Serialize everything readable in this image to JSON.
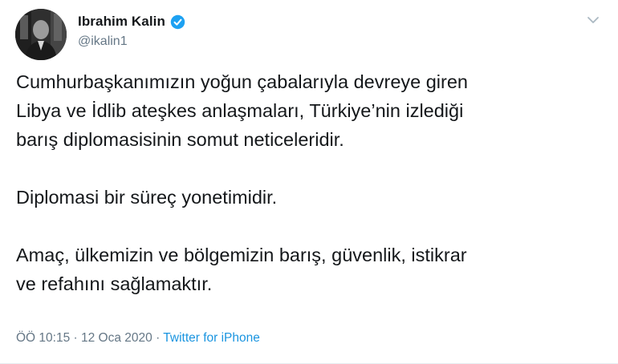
{
  "author": {
    "display_name": "Ibrahim Kalin",
    "handle": "@ikalin1",
    "verified": true
  },
  "tweet": {
    "paragraphs": [
      "Cumhurbaşkanımızın yoğun çabalarıyla devreye giren\nLibya ve İdlib ateşkes anlaşmaları, Türkiye’nin izlediği\nbarış diplomasisinin somut neticeleridir.",
      "Diplomasi bir süreç yonetimidir.",
      "Amaç, ülkemizin ve bölgemizin barış, güvenlik, istikrar\nve refahını sağlamaktır."
    ]
  },
  "meta": {
    "time": "ÖÖ 10:15",
    "separator": " · ",
    "date": "12 Oca 2020",
    "source": "Twitter for iPhone"
  },
  "colors": {
    "accent": "#1b95e0",
    "muted": "#657786",
    "text": "#14171a"
  },
  "icons": {
    "verified": "verified-badge-icon",
    "menu": "chevron-down-icon"
  }
}
